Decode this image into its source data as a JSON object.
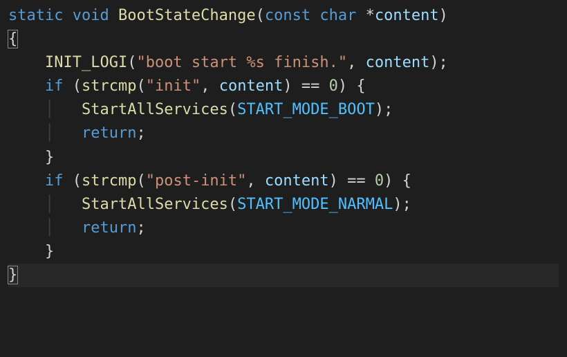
{
  "code": {
    "kw_static": "static",
    "kw_void": "void",
    "fn_BootStateChange": "BootStateChange",
    "kw_const": "const",
    "kw_char": "char",
    "star": "*",
    "param_content": "content",
    "fn_INIT_LOGI": "INIT_LOGI",
    "str_boot_start": "\"boot start %s finish.\"",
    "kw_if": "if",
    "fn_strcmp": "strcmp",
    "str_init": "\"init\"",
    "eqeq": "==",
    "num_zero": "0",
    "fn_StartAllServices": "StartAllServices",
    "const_START_MODE_BOOT": "START_MODE_BOOT",
    "kw_return": "return",
    "str_post_init": "\"post-init\"",
    "const_START_MODE_NARMAL": "START_MODE_NARMAL"
  }
}
